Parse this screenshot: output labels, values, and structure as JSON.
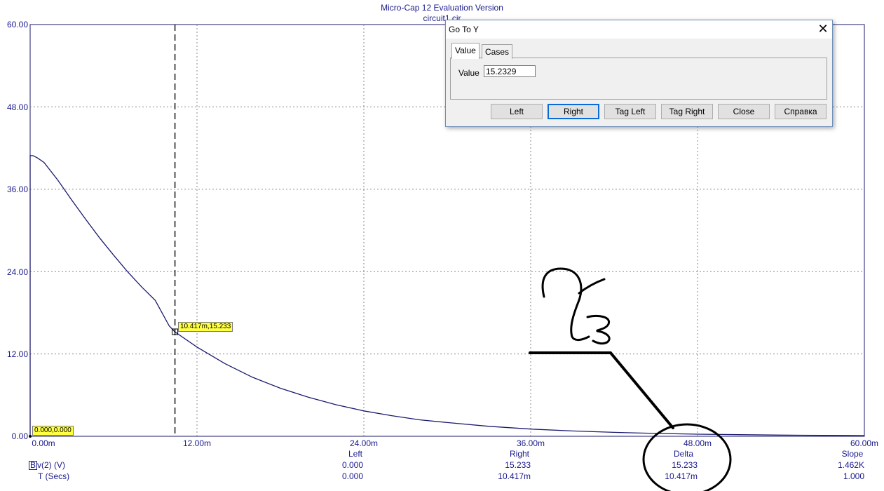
{
  "window": {
    "title": "Micro-Cap 12 Evaluation Version",
    "subtitle": "circuit1.cir"
  },
  "chart_data": {
    "type": "line",
    "x_unit": "s",
    "xlim": [
      0,
      0.06
    ],
    "ylim": [
      0,
      60
    ],
    "y_ticks": [
      "60.00",
      "48.00",
      "36.00",
      "24.00",
      "12.00",
      "0.00"
    ],
    "x_ticks": [
      "0.00m",
      "12.00m",
      "24.00m",
      "36.00m",
      "48.00m",
      "60.00m"
    ],
    "grid": true,
    "y_expression": "v(2) (V)",
    "x_expression": "T (Secs)",
    "series": [
      {
        "color": "#1a1a6e",
        "x": [
          0,
          0,
          0.0002,
          0.0005,
          0.001,
          0.002,
          0.003,
          0.004,
          0.005,
          0.006,
          0.007,
          0.008,
          0.009,
          0.01,
          0.0104,
          0.012,
          0.014,
          0.016,
          0.018,
          0.02,
          0.022,
          0.024,
          0.026,
          0.028,
          0.03,
          0.033,
          0.036,
          0.039,
          0.042,
          0.045,
          0.048,
          0.051,
          0.054,
          0.057,
          0.06
        ],
        "y": [
          0,
          40.9,
          40.9,
          40.6,
          39.9,
          37.3,
          34.4,
          31.6,
          28.9,
          26.4,
          24.0,
          21.8,
          19.8,
          16.1,
          15.23,
          13.0,
          10.6,
          8.6,
          7.0,
          5.7,
          4.6,
          3.7,
          3.0,
          2.4,
          2.0,
          1.45,
          1.05,
          0.78,
          0.57,
          0.42,
          0.31,
          0.23,
          0.17,
          0.13,
          0.1
        ]
      }
    ],
    "cursor_left": {
      "x": 0.0,
      "y": 0.0,
      "tag": "0.000,0.000"
    },
    "cursor_right": {
      "x": 0.010417,
      "y": 15.233,
      "tag": "10.417m,15.233"
    }
  },
  "cursor_table": {
    "headers": [
      "Left",
      "Right",
      "Delta",
      "Slope"
    ],
    "row1_label_prefix": "B",
    "row1_label": "v(2) (V)",
    "row1": [
      "0.000",
      "15.233",
      "15.233",
      "1.462K"
    ],
    "row2_label": "T (Secs)",
    "row2": [
      "0.000",
      "10.417m",
      "10.417m",
      "1.000"
    ]
  },
  "dialog": {
    "title": "Go To Y",
    "close": "✕",
    "tabs": [
      "Value",
      "Cases"
    ],
    "value_label": "Value",
    "value": "15.2329",
    "buttons": [
      "Left",
      "Right",
      "Tag Left",
      "Tag Right",
      "Close",
      "Справка"
    ]
  },
  "annotation": {
    "handwritten_text": "2,3"
  }
}
